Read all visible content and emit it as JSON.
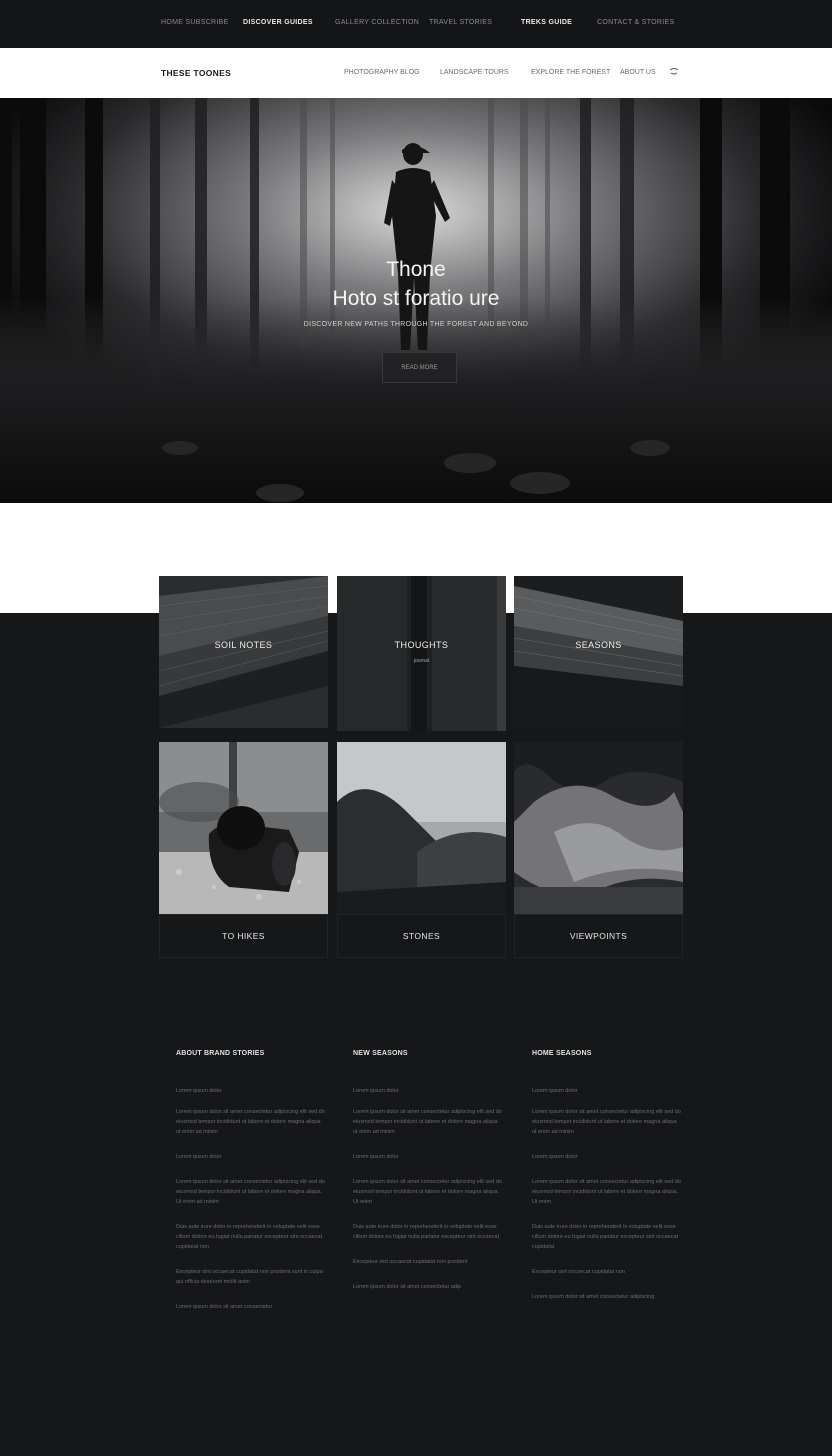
{
  "topbar": {
    "items": [
      "HOME SUBSCRIBE",
      "DISCOVER GUIDES",
      "GALLERY COLLECTION",
      "TRAVEL STORIES",
      "TREKS GUIDE",
      "CONTACT & STORIES"
    ]
  },
  "navbar": {
    "logo": "THESE TOONES",
    "links": [
      "PHOTOGRAPHY BLOG",
      "LANDSCAPE TOURS",
      "EXPLORE THE FOREST",
      "ABOUT US"
    ],
    "icon": "menu-icon"
  },
  "hero": {
    "pretitle": "Thone",
    "title": "Hoto st foratio ure",
    "subtitle": "DISCOVER NEW PATHS THROUGH THE FOREST AND BEYOND",
    "cta": "READ MORE"
  },
  "tiles": [
    {
      "caption": "SOIL NOTES"
    },
    {
      "caption": "THOUGHTS",
      "subcaption": "journal"
    },
    {
      "caption": "SEASONS"
    },
    {
      "footer": "TO HIKES"
    },
    {
      "footer": "STONES"
    },
    {
      "footer": "VIEWPOINTS"
    }
  ],
  "columns": [
    {
      "heading": "ABOUT BRAND STORIES",
      "kicker": "Lorem ipsum dolor",
      "paragraphs": [
        "Lorem ipsum dolor sit amet consectetur adipiscing elit sed do eiusmod tempor incididunt ut labore et dolore magna aliqua ut enim ad minim",
        "Lorem ipsum dolor",
        "Lorem ipsum dolor sit amet consectetur adipiscing elit sed do eiusmod tempor incididunt ut labore et dolore magna aliqua. Ut enim ad minim",
        "Duis aute irure dolor in reprehenderit in voluptate velit esse cillum dolore eu fugiat nulla pariatur excepteur sint occaecat cupidatat non",
        "Excepteur sint occaecat cupidatat non proident sunt in culpa qui officia deserunt mollit anim",
        "Lorem ipsum dolor sit amet consectetur"
      ]
    },
    {
      "heading": "NEW SEASONS",
      "kicker": "Lorem ipsum dolor",
      "paragraphs": [
        "Lorem ipsum dolor sit amet consectetur adipiscing elit sed do eiusmod tempor incididunt ut labore et dolore magna aliqua ut enim ad minim",
        "Lorem ipsum dolor",
        "Lorem ipsum dolor sit amet consectetur adipiscing elit sed do eiusmod tempor incididunt ut labore et dolore magna aliqua. Ut enim",
        "Duis aute irure dolor in reprehenderit in voluptate velit esse cillum dolore eu fugiat nulla pariatur excepteur sint occaecat",
        "Excepteur sint occaecat cupidatat non proident",
        "Lorem ipsum dolor sit amet consectetur adip"
      ]
    },
    {
      "heading": "HOME SEASONS",
      "kicker": "Lorem ipsum dolor",
      "paragraphs": [
        "Lorem ipsum dolor sit amet consectetur adipiscing elit sed do eiusmod tempor incididunt ut labore et dolore magna aliqua ut enim ad minim",
        "Lorem ipsum dolor",
        "Lorem ipsum dolor sit amet consectetur adipiscing elit sed do eiusmod tempor incididunt ut labore et dolore magna aliqua. Ut enim",
        "Duis aute irure dolor in reprehenderit in voluptate velit esse cillum dolore eu fugiat nulla pariatur excepteur sint occaecat cupidatat",
        "Excepteur sint occaecat cupidatat non",
        "Lorem ipsum dolor sit amet consectetur adipiscing"
      ]
    }
  ]
}
